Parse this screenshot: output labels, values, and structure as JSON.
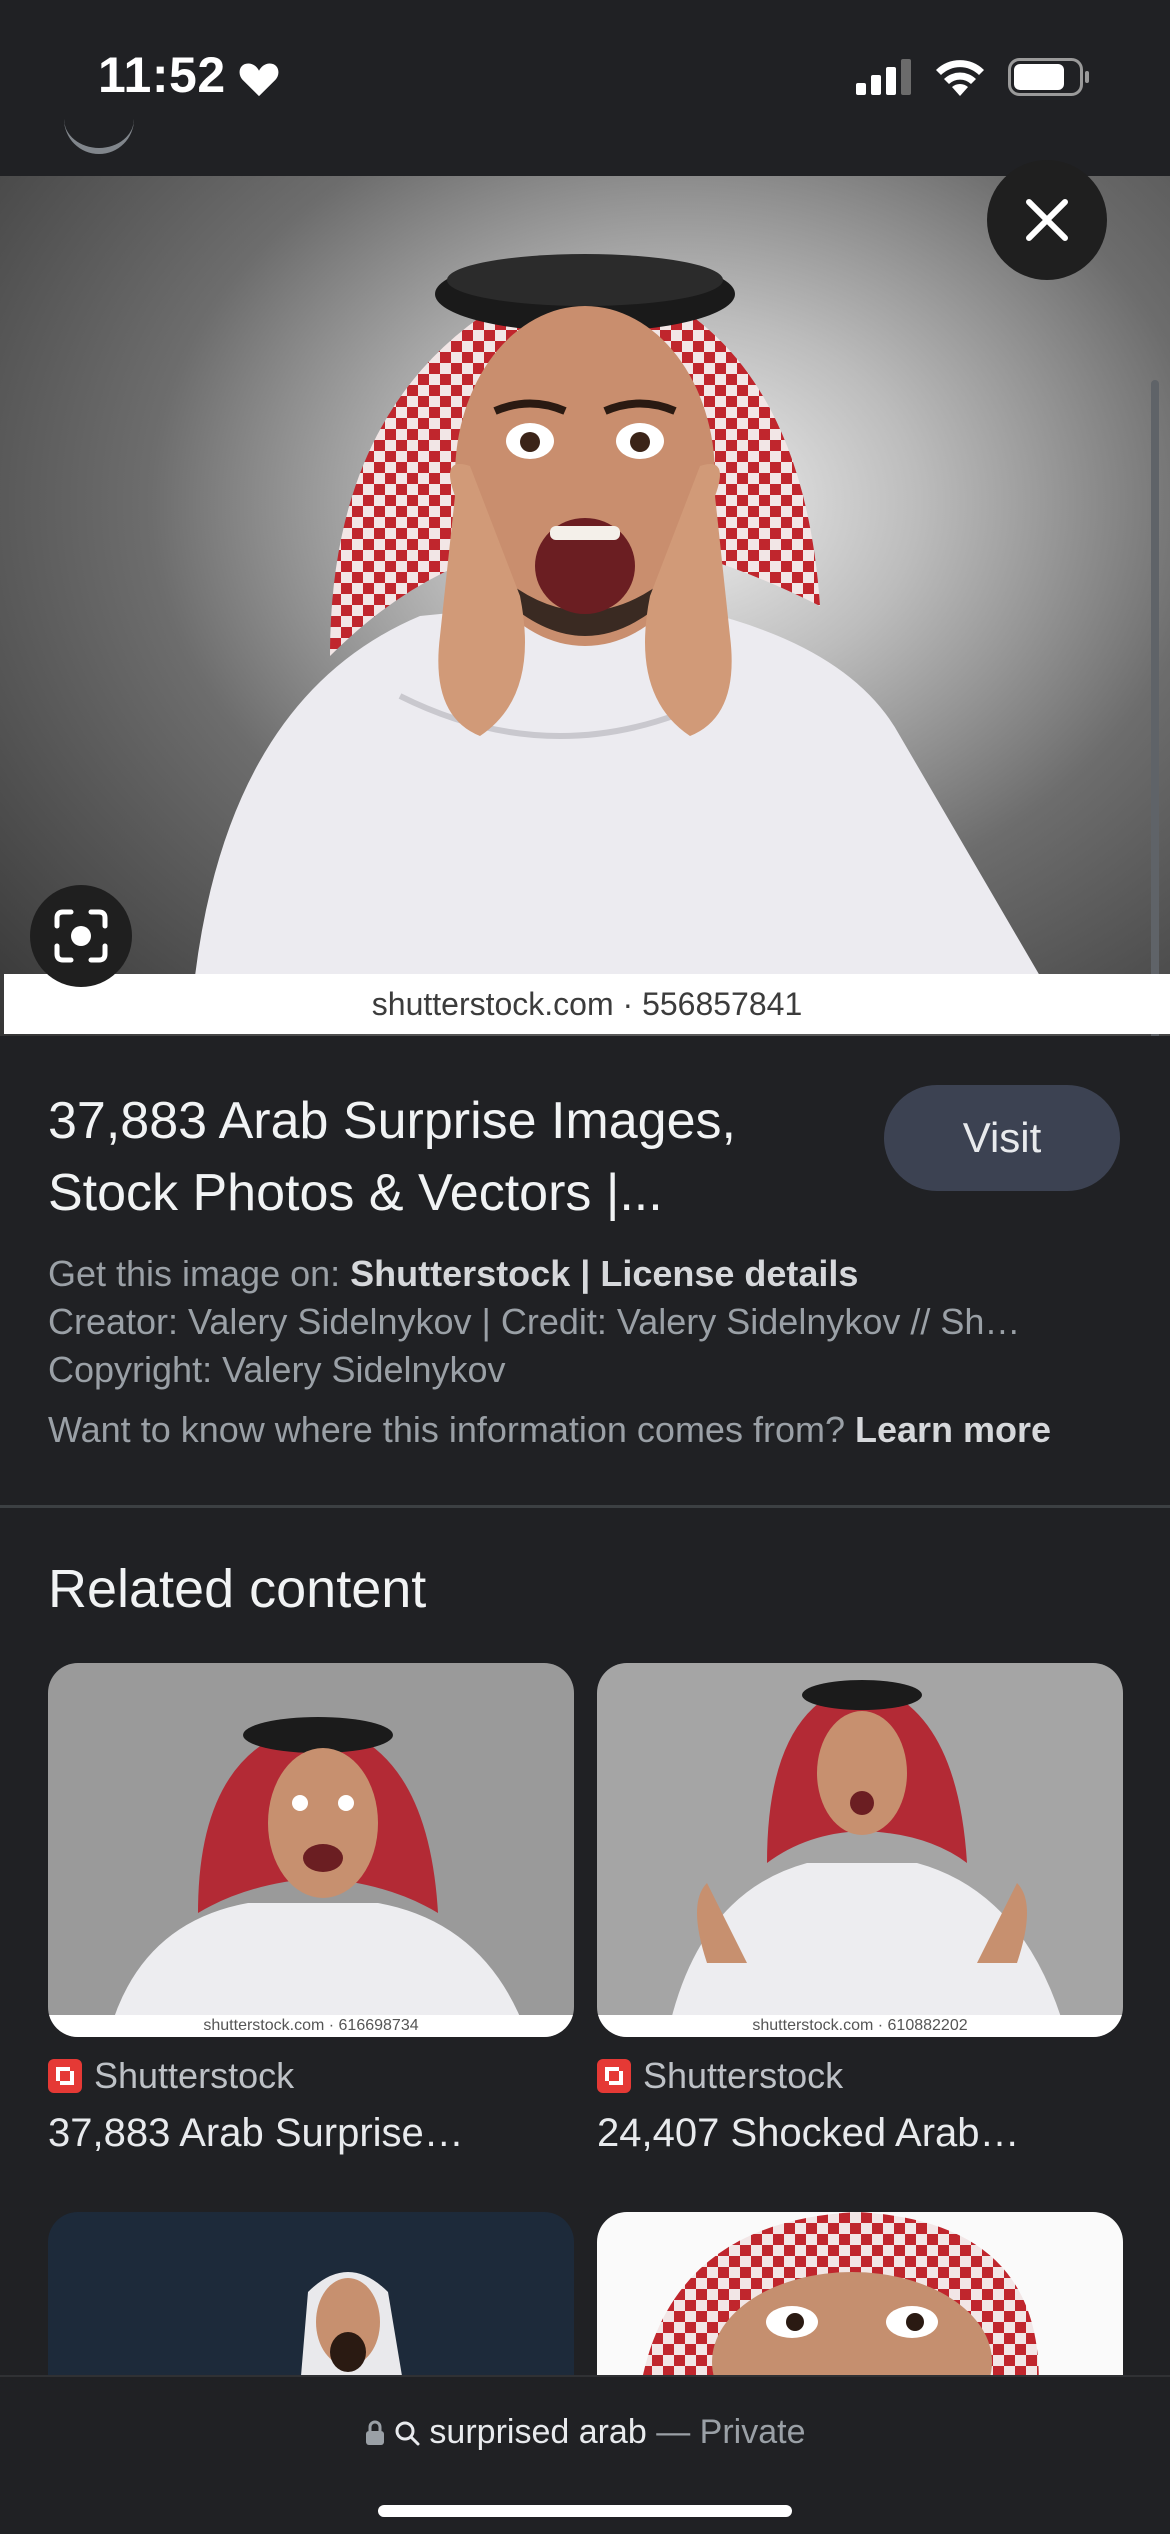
{
  "status": {
    "time": "11:52",
    "icons": [
      "heart-icon",
      "signal-icon",
      "wifi-icon",
      "battery-icon"
    ]
  },
  "hero": {
    "caption": "shutterstock.com · 556857841",
    "close_icon": "close-icon",
    "lens_icon": "google-lens-icon"
  },
  "result": {
    "title": "37,883 Arab Surprise Images, Stock Photos & Vectors |...",
    "visit_label": "Visit",
    "get_image_prefix": "Get this image on:",
    "source_name": "Shutterstock",
    "separator": "|",
    "license_label": "License details",
    "creator_line": "Creator: Valery Sidelnykov | Credit: Valery Sidelnykov // Sh…",
    "copyright_line": "Copyright: Valery Sidelnykov",
    "info_question": "Want to know where this information comes from?",
    "learn_more": "Learn more"
  },
  "related": {
    "heading": "Related content",
    "items": [
      {
        "source": "Shutterstock",
        "title": "37,883 Arab Surprise…",
        "caption": "shutterstock.com · 616698734"
      },
      {
        "source": "Shutterstock",
        "title": "24,407 Shocked Arab…",
        "caption": "shutterstock.com · 610882202"
      }
    ]
  },
  "bottom": {
    "query": "surprised arab",
    "mode": "— Private"
  },
  "colors": {
    "background": "#202124",
    "visit_button": "#3c4252",
    "shutterstock_red": "#e53935"
  }
}
